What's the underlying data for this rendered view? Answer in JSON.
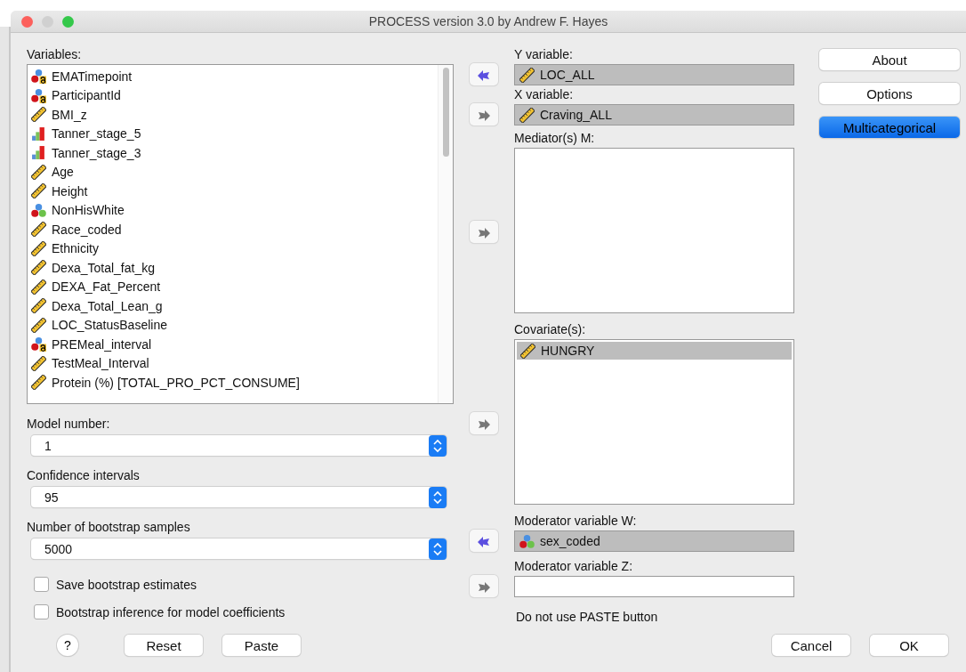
{
  "window": {
    "title": "PROCESS version 3.0 by Andrew F. Hayes"
  },
  "variables": {
    "label": "Variables:",
    "items": [
      {
        "name": "EMATimepoint",
        "kind": "nominal-string"
      },
      {
        "name": "ParticipantId",
        "kind": "nominal-string"
      },
      {
        "name": "BMI_z",
        "kind": "scale"
      },
      {
        "name": "Tanner_stage_5",
        "kind": "ordinal"
      },
      {
        "name": "Tanner_stage_3",
        "kind": "ordinal"
      },
      {
        "name": "Age",
        "kind": "scale"
      },
      {
        "name": "Height",
        "kind": "scale"
      },
      {
        "name": "NonHisWhite",
        "kind": "nominal"
      },
      {
        "name": "Race_coded",
        "kind": "scale"
      },
      {
        "name": "Ethnicity",
        "kind": "scale"
      },
      {
        "name": "Dexa_Total_fat_kg",
        "kind": "scale"
      },
      {
        "name": "DEXA_Fat_Percent",
        "kind": "scale"
      },
      {
        "name": "Dexa_Total_Lean_g",
        "kind": "scale"
      },
      {
        "name": "LOC_StatusBaseline",
        "kind": "scale"
      },
      {
        "name": "PREMeal_interval",
        "kind": "nominal-string"
      },
      {
        "name": "TestMeal_Interval",
        "kind": "scale"
      },
      {
        "name": " Protein (%) [TOTAL_PRO_PCT_CONSUME]",
        "kind": "scale"
      }
    ]
  },
  "dropdowns": [
    {
      "label": "Model number:",
      "value": "1"
    },
    {
      "label": "Confidence intervals",
      "value": "95"
    },
    {
      "label": "Number of bootstrap samples",
      "value": "5000"
    }
  ],
  "checkboxes": [
    {
      "label": "Save bootstrap estimates",
      "checked": false
    },
    {
      "label": "Bootstrap inference for model coefficients",
      "checked": false
    }
  ],
  "slots": [
    {
      "label": "Y variable:",
      "kind": "field",
      "arrow_points_left": true,
      "items": [
        {
          "name": "LOC_ALL",
          "kind": "scale"
        }
      ]
    },
    {
      "label": "X variable:",
      "kind": "field",
      "arrow_points_left": false,
      "items": [
        {
          "name": "Craving_ALL",
          "kind": "scale"
        }
      ]
    },
    {
      "label": "Mediator(s) M:",
      "kind": "list",
      "arrow_points_left": false
    },
    {
      "label": "Covariate(s):",
      "kind": "list",
      "arrow_points_left": false,
      "items": [
        {
          "name": "HUNGRY",
          "kind": "scale"
        }
      ]
    },
    {
      "label": "Moderator variable W:",
      "kind": "field",
      "arrow_points_left": true,
      "items": [
        {
          "name": "sex_coded",
          "kind": "nominal"
        }
      ]
    },
    {
      "label": "Moderator variable Z:",
      "kind": "field",
      "arrow_points_left": false
    }
  ],
  "note": "Do not use PASTE button",
  "side_buttons": [
    {
      "label": "About",
      "selected": false
    },
    {
      "label": "Options",
      "selected": false
    },
    {
      "label": "Multicategorical",
      "selected": true
    }
  ],
  "help": "?",
  "bottom_left_buttons": [
    "Reset",
    "Paste"
  ],
  "bottom_right_buttons": [
    "Cancel",
    "OK"
  ]
}
